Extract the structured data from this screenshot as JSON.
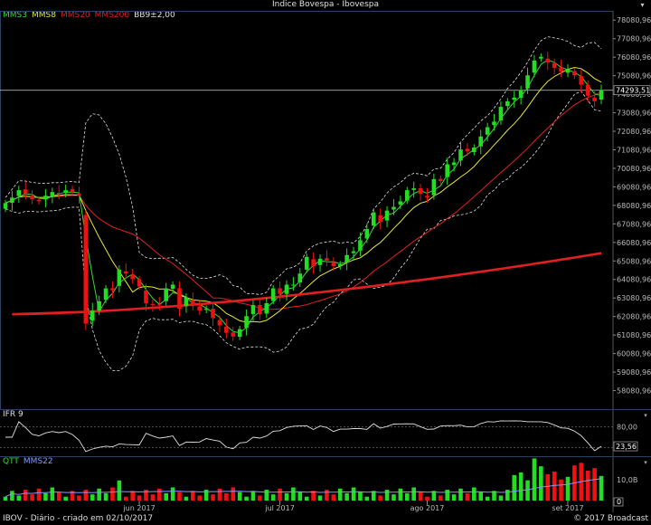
{
  "window": {
    "title": "Índice Bovespa - Ibovespa",
    "menu_icon": "chevron-down-icon"
  },
  "legend_main": [
    {
      "label": "MMS3",
      "color": "#33dd33"
    },
    {
      "label": "MMS8",
      "color": "#e8e830"
    },
    {
      "label": "MMS20",
      "color": "#e02020"
    },
    {
      "label": "MMS200",
      "color": "#e02020"
    },
    {
      "label": "BB9±2,00",
      "color": "#e0e0e0"
    }
  ],
  "price_axis": {
    "ticks": [
      "78080,96",
      "77080,96",
      "76080,96",
      "75080,96",
      "74080,96",
      "73080,96",
      "72080,96",
      "71080,96",
      "70080,96",
      "69080,96",
      "68080,96",
      "67080,96",
      "66080,96",
      "65080,96",
      "64080,96",
      "63080,96",
      "62080,96",
      "61080,96",
      "60080,96",
      "59080,96",
      "58080,96"
    ],
    "current_value": "74293,51",
    "min": 57080.96,
    "max": 78580.96
  },
  "date_axis": [
    "jun 2017",
    "jul 2017",
    "ago 2017",
    "set 2017"
  ],
  "ifr": {
    "label": "IFR 9",
    "ticks": [
      "80,00"
    ],
    "current_value": "23,56"
  },
  "volume": {
    "labels": [
      {
        "label": "QTT",
        "color": "#33dd33"
      },
      {
        "label": "MMS22",
        "color": "#8899ff"
      }
    ],
    "ticks": [
      "10,0B",
      "0"
    ]
  },
  "footer": {
    "left": "IBOV - Diário - criado em 02/10/2017",
    "right": "© 2017 Broadcast"
  },
  "colors": {
    "up": "#22dd22",
    "down": "#ee1111",
    "mms3": "#33dd33",
    "mms8": "#e8e830",
    "mms20": "#e02020",
    "mms200": "#e02020",
    "bb": "#e0e0e0",
    "ifr": "#e0e0e0",
    "mms22": "#8899ff"
  },
  "chart_data": {
    "type": "candlestick",
    "title": "Índice Bovespa - Ibovespa",
    "x_range": [
      "2017-05-03",
      "2017-10-02"
    ],
    "y_range": [
      57080.96,
      78580.96
    ],
    "date_ticks": [
      "jun 2017",
      "jul 2017",
      "ago 2017",
      "set 2017"
    ],
    "closes": [
      68200,
      68500,
      68900,
      68700,
      68400,
      68300,
      68600,
      68800,
      68700,
      68900,
      68800,
      68600,
      61700,
      62400,
      62900,
      63600,
      63500,
      64600,
      64400,
      64100,
      63700,
      62800,
      62700,
      62700,
      63600,
      63800,
      62500,
      63100,
      62700,
      62400,
      62500,
      62000,
      61600,
      61200,
      61000,
      61400,
      62100,
      62700,
      62200,
      62800,
      63600,
      63300,
      63800,
      63800,
      64400,
      65300,
      64800,
      65200,
      65100,
      64800,
      64900,
      65400,
      65600,
      66200,
      66800,
      67700,
      67200,
      67800,
      68000,
      68300,
      68900,
      69000,
      68700,
      68500,
      69500,
      69400,
      70300,
      70400,
      71100,
      71000,
      71200,
      71800,
      72300,
      72600,
      73400,
      73700,
      73900,
      74300,
      75100,
      75900,
      76100,
      75800,
      75500,
      75300,
      75400,
      75100,
      74600,
      74000,
      73700,
      74300
    ],
    "mms200_start": 62200,
    "mms200_end": 65500,
    "ifr_current": 23.56,
    "legend": [
      "MMS3",
      "MMS8",
      "MMS20",
      "MMS200",
      "BB9±2,00"
    ]
  }
}
